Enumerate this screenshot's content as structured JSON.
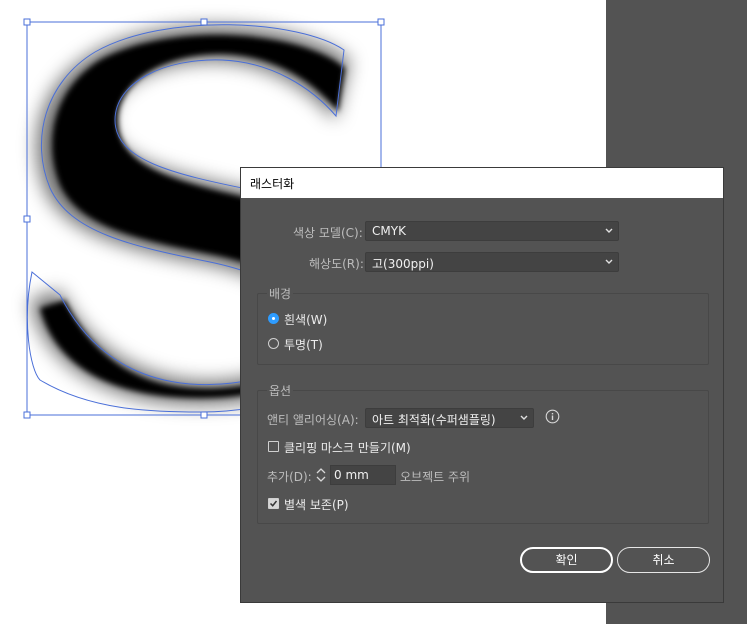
{
  "dialog": {
    "title": "래스터화",
    "color_model_label": "색상 모델(C):",
    "color_model_value": "CMYK",
    "resolution_label": "해상도(R):",
    "resolution_value": "고(300ppi)",
    "background": {
      "legend": "배경",
      "white_label": "흰색(W)",
      "transparent_label": "투명(T)",
      "selected": "white"
    },
    "options": {
      "legend": "옵션",
      "antialias_label": "앤티 앨리어싱(A):",
      "antialias_value": "아트 최적화(수퍼샘플링)",
      "clipping_mask_label": "클리핑 마스크 만들기(M)",
      "clipping_mask_checked": false,
      "add_label": "추가(D):",
      "add_value": "0 mm",
      "around_object_label": "오브젝트 주위",
      "preserve_spot_label": "별색 보존(P)",
      "preserve_spot_checked": true
    },
    "ok_label": "확인",
    "cancel_label": "취소"
  },
  "colors": {
    "dialog_bg": "#535353",
    "accent": "#2e9cff",
    "selection": "#4a6fd8"
  },
  "icons": [
    "chevron-down-icon",
    "info-icon",
    "stepper-icon",
    "checkmark-icon"
  ]
}
